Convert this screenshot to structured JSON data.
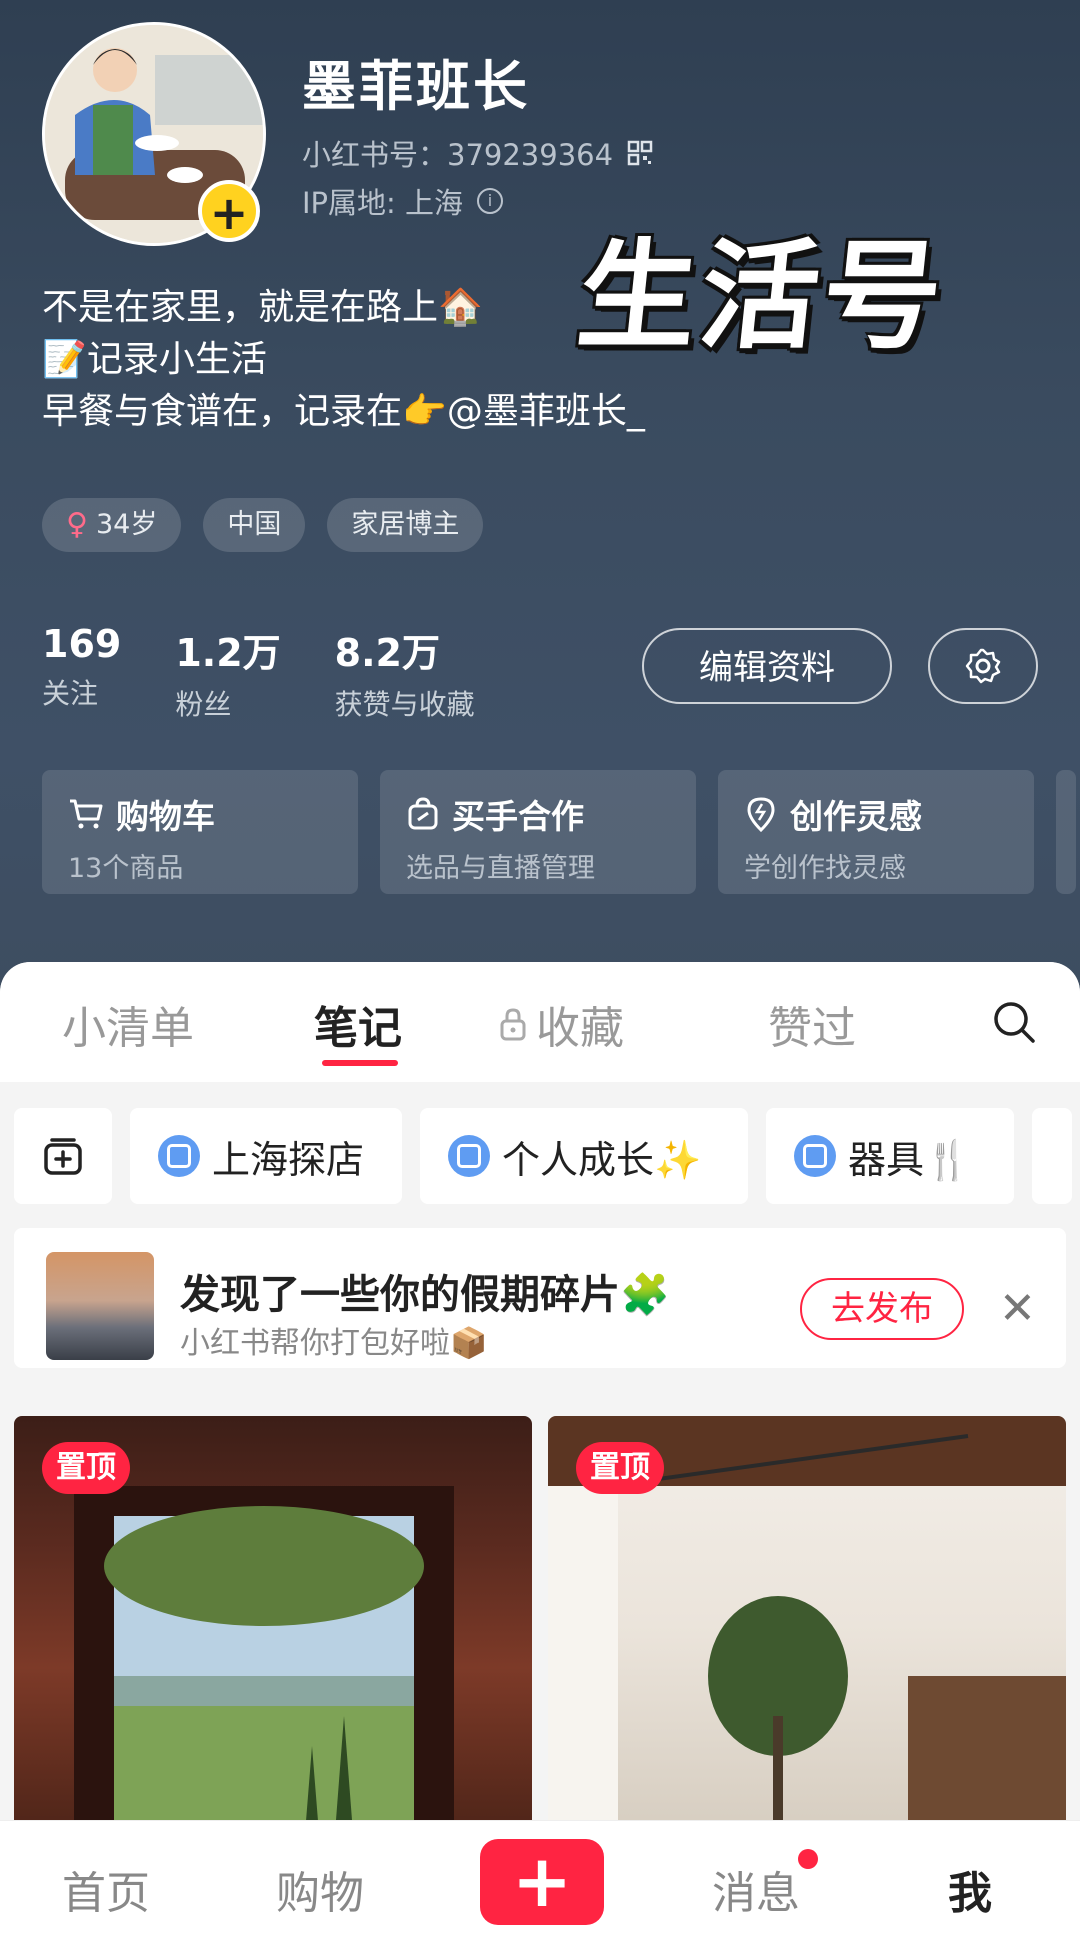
{
  "profile": {
    "name": "墨菲班长",
    "id_line": "小红书号：379239364",
    "ip_line": "IP属地: 上海",
    "sticker": "生活号",
    "bio": [
      "不是在家里，就是在路上🏠",
      "📝记录小生活",
      "早餐与食谱在，记录在👉@墨菲班长_"
    ],
    "tags": [
      "34岁",
      "中国",
      "家居博主"
    ],
    "stats": [
      {
        "num": "169",
        "label": "关注"
      },
      {
        "num": "1.2万",
        "label": "粉丝"
      },
      {
        "num": "8.2万",
        "label": "获赞与收藏"
      }
    ],
    "edit_label": "编辑资料"
  },
  "cards": [
    {
      "icon": "cart-icon",
      "title": "购物车",
      "sub": "13个商品"
    },
    {
      "icon": "bag-icon",
      "title": "买手合作",
      "sub": "选品与直播管理"
    },
    {
      "icon": "lightbulb-icon",
      "title": "创作灵感",
      "sub": "学创作找灵感"
    }
  ],
  "tabs": [
    "小清单",
    "笔记",
    "收藏",
    "赞过"
  ],
  "active_tab": "笔记",
  "collections": [
    "上海探店",
    "个人成长✨",
    "器具🍴"
  ],
  "promo": {
    "title": "发现了一些你的假期碎片🧩",
    "sub": "小红书帮你打包好啦📦",
    "button": "去发布"
  },
  "notes": [
    {
      "badge": "置顶"
    },
    {
      "badge": "置顶"
    }
  ],
  "bottom_nav": [
    "首页",
    "购物",
    "消息",
    "我"
  ],
  "colors": {
    "accent": "#ff2442",
    "hero_bg": "#3a4b5f",
    "avatar_badge": "#ffd21f"
  }
}
